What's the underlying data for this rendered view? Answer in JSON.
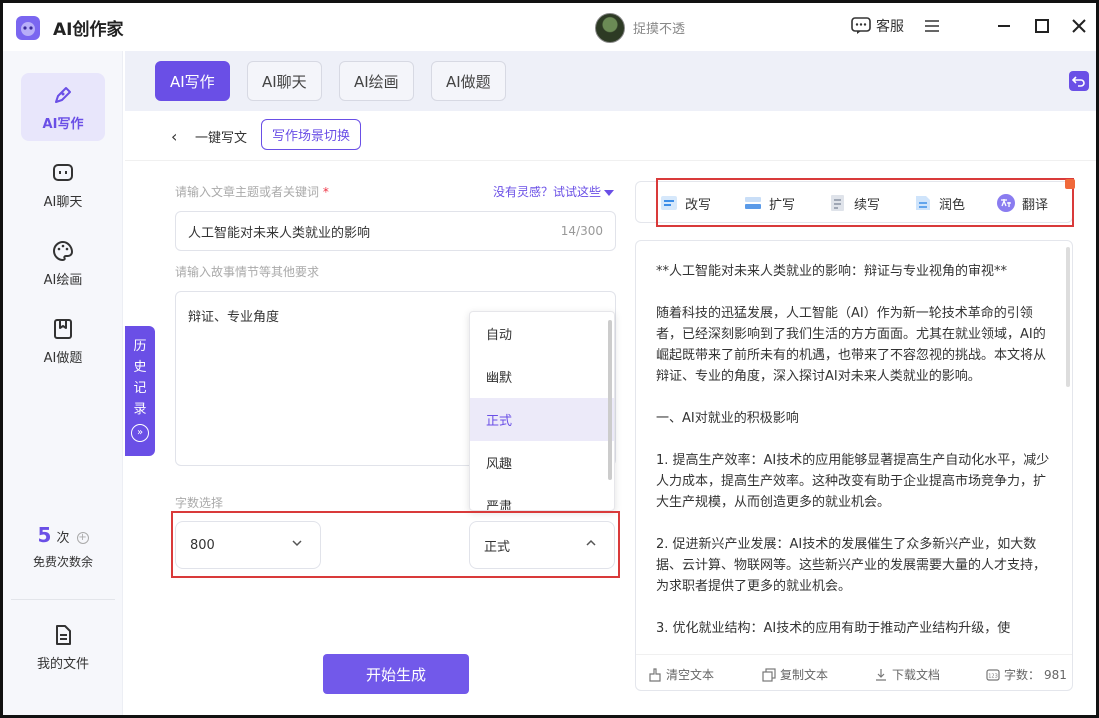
{
  "app": {
    "title": "AI创作家",
    "user_name": "捉摸不透",
    "service_label": "客服"
  },
  "sidebar": {
    "items": [
      {
        "label": "AI写作",
        "icon": "pen-icon"
      },
      {
        "label": "AI聊天",
        "icon": "chat-icon"
      },
      {
        "label": "AI绘画",
        "icon": "palette-icon"
      },
      {
        "label": "AI做题",
        "icon": "bookmark-icon"
      }
    ],
    "credits": {
      "count": "5",
      "unit": "次",
      "label": "免费次数余"
    },
    "files_label": "我的文件"
  },
  "tabs": [
    "AI写作",
    "AI聊天",
    "AI绘画",
    "AI做题"
  ],
  "subbar": {
    "title": "一键写文",
    "scene_button": "写作场景切换"
  },
  "form": {
    "topic_label": "请输入文章主题或者关键词",
    "required_mark": "*",
    "inspire_link": "没有灵感？试试这些",
    "topic_value": "人工智能对未来人类就业的影响",
    "topic_count": "14/300",
    "story_label": "请输入故事情节等其他要求",
    "story_value": "辩证、专业角度",
    "tone_options": [
      "自动",
      "幽默",
      "正式",
      "风趣",
      "严肃"
    ],
    "word_count_label": "字数选择",
    "word_count_value": "800",
    "tone_value": "正式",
    "generate_button": "开始生成"
  },
  "history_tab": [
    "历",
    "史",
    "记",
    "录"
  ],
  "tools": [
    "改写",
    "扩写",
    "续写",
    "润色",
    "翻译"
  ],
  "article": {
    "paragraphs": [
      "**人工智能对未来人类就业的影响：辩证与专业视角的审视**",
      "随着科技的迅猛发展，人工智能（AI）作为新一轮技术革命的引领者，已经深刻影响到了我们生活的方方面面。尤其在就业领域，AI的崛起既带来了前所未有的机遇，也带来了不容忽视的挑战。本文将从辩证、专业的角度，深入探讨AI对未来人类就业的影响。",
      "一、AI对就业的积极影响",
      "1. 提高生产效率：AI技术的应用能够显著提高生产自动化水平，减少人力成本，提高生产效率。这种改变有助于企业提高市场竞争力，扩大生产规模，从而创造更多的就业机会。",
      "2. 促进新兴产业发展：AI技术的发展催生了众多新兴产业，如大数据、云计算、物联网等。这些新兴产业的发展需要大量的人才支持，为求职者提供了更多的就业机会。",
      "3. 优化就业结构：AI技术的应用有助于推动产业结构升级，使"
    ]
  },
  "article_footer": {
    "clear": "清空文本",
    "copy": "复制文本",
    "download": "下载文档",
    "count_label": "字数：",
    "count_value": "981"
  },
  "colors": {
    "accent": "#6a4fe6",
    "highlight_box": "#d93a3a"
  }
}
